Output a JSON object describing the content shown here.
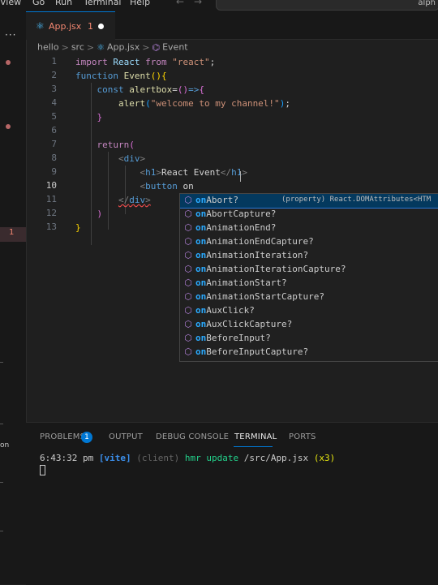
{
  "menu": {
    "items": [
      "View",
      "Go",
      "Run",
      "Terminal",
      "Help"
    ],
    "back_arrow": "←",
    "forward_arrow": "→",
    "command_center_text": "alph"
  },
  "activity_bar": {
    "dots": "···",
    "problem_count": "1",
    "bottom_text": "on"
  },
  "tab": {
    "icon": "react-icon",
    "label": "App.jsx",
    "problem_count": "1",
    "dirty": true
  },
  "breadcrumb": {
    "items": [
      "hello",
      "src",
      "App.jsx",
      "Event"
    ],
    "separator": ">"
  },
  "editor": {
    "active_line": 10,
    "lines": [
      {
        "n": "1"
      },
      {
        "n": "2"
      },
      {
        "n": "3"
      },
      {
        "n": "4"
      },
      {
        "n": "5"
      },
      {
        "n": "6"
      },
      {
        "n": "7"
      },
      {
        "n": "8"
      },
      {
        "n": "9"
      },
      {
        "n": "10"
      },
      {
        "n": "11"
      },
      {
        "n": "12"
      },
      {
        "n": "13"
      }
    ],
    "tokens": {
      "l1_import": "import",
      "l1_react": "React",
      "l1_from": "from",
      "l1_str": "\"react\"",
      "l1_semi": ";",
      "l2_function": "function",
      "l2_name": "Event",
      "l2_parens": "()",
      "l2_brace": "{",
      "l3_const": "const",
      "l3_var": "alertbox",
      "l3_eq": "=",
      "l3_parens": "()",
      "l3_arrow": "=>",
      "l3_brace": "{",
      "l4_alert": "alert",
      "l4_open": "(",
      "l4_str": "\"welcome to my channel!\"",
      "l4_close": ")",
      "l4_semi": ";",
      "l5_brace": "}",
      "l7_return": "return",
      "l7_paren": "(",
      "l8_open": "<",
      "l8_div": "div",
      "l8_close": ">",
      "l9_open": "<",
      "l9_h1": "h1",
      "l9_gt": ">",
      "l9_text": "React Event",
      "l9_close_open": "</",
      "l9_h1b": "h1",
      "l9_gt2": ">",
      "l10_lt": "<",
      "l10_button": "button",
      "l10_text": " on",
      "l11_open": "</",
      "l11_div": "div",
      "l11_gt": ">",
      "l12_paren": ")",
      "l13_brace": "}"
    }
  },
  "suggest": {
    "typed": "on",
    "selected_detail": "(property) React.DOMAttributes<HTM",
    "items": [
      {
        "rest": "Abort?"
      },
      {
        "rest": "AbortCapture?"
      },
      {
        "rest": "AnimationEnd?"
      },
      {
        "rest": "AnimationEndCapture?"
      },
      {
        "rest": "AnimationIteration?"
      },
      {
        "rest": "AnimationIterationCapture?"
      },
      {
        "rest": "AnimationStart?"
      },
      {
        "rest": "AnimationStartCapture?"
      },
      {
        "rest": "AuxClick?"
      },
      {
        "rest": "AuxClickCapture?"
      },
      {
        "rest": "BeforeInput?"
      },
      {
        "rest": "BeforeInputCapture?"
      }
    ]
  },
  "panel": {
    "tabs": [
      "PROBLEMS",
      "OUTPUT",
      "DEBUG CONSOLE",
      "TERMINAL",
      "PORTS"
    ],
    "active_tab": "TERMINAL",
    "problems_badge": "1",
    "terminal": {
      "time": "6:43:32 pm",
      "tag": "[vite]",
      "client": "(client)",
      "message": "hmr update",
      "path": "/src/App.jsx",
      "count": "(x3)"
    }
  },
  "colors": {
    "accent": "#0078d4",
    "error": "#f48771",
    "background": "#1f1f1f"
  }
}
